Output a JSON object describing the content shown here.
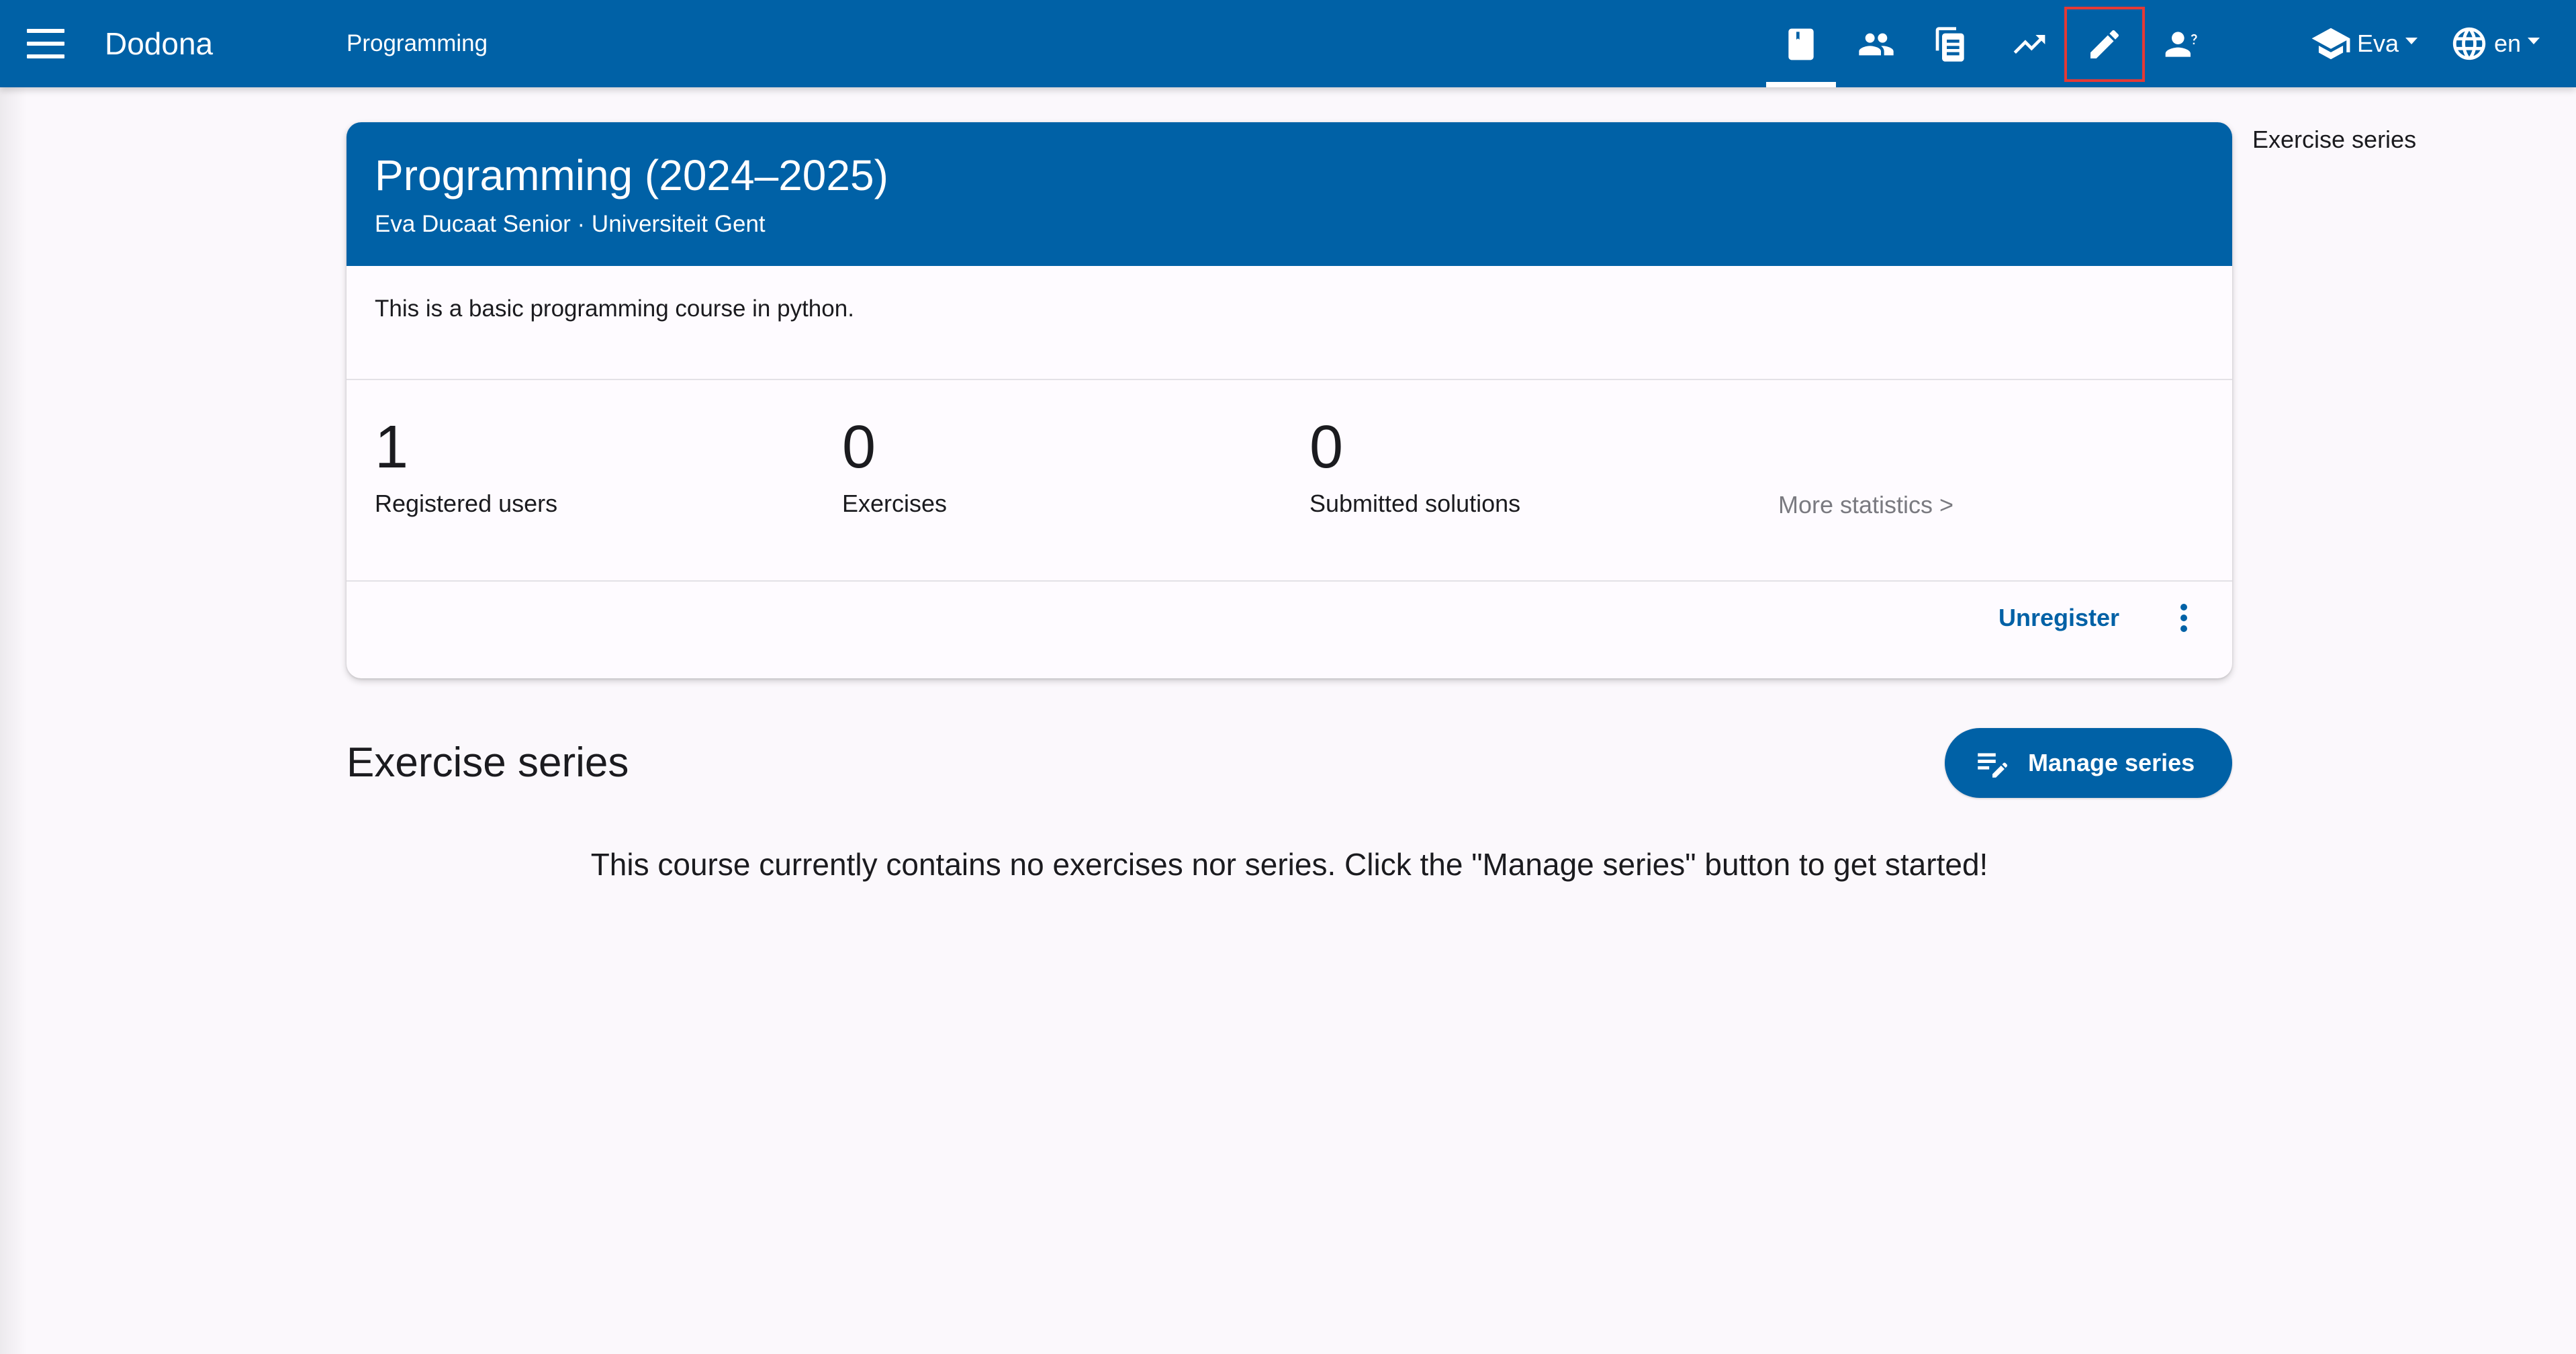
{
  "app": {
    "brand": "Dodona",
    "course_crumb": "Programming"
  },
  "nav": {
    "icons": [
      "course-book-icon",
      "users-icon",
      "submissions-icon",
      "statistics-icon",
      "edit-pencil-icon",
      "user-question-icon"
    ],
    "user_label": "Eva",
    "language_label": "en"
  },
  "course": {
    "title": "Programming (2024–2025)",
    "subtitle": "Eva Ducaat Senior · Universiteit Gent",
    "description": "This is a basic programming course in python.",
    "stats": [
      {
        "value": "1",
        "label": "Registered users"
      },
      {
        "value": "0",
        "label": "Exercises"
      },
      {
        "value": "0",
        "label": "Submitted solutions"
      }
    ],
    "more_stats_label": "More statistics >",
    "unregister_label": "Unregister"
  },
  "series": {
    "title": "Exercise series",
    "manage_label": "Manage series",
    "empty_message": "This course currently contains no exercises nor series. Click the \"Manage series\" button to get started!"
  },
  "toc": {
    "link_label": "Exercise series"
  },
  "colors": {
    "primary": "#0061a6",
    "background": "#fbf8fc",
    "highlight": "#e53935"
  }
}
